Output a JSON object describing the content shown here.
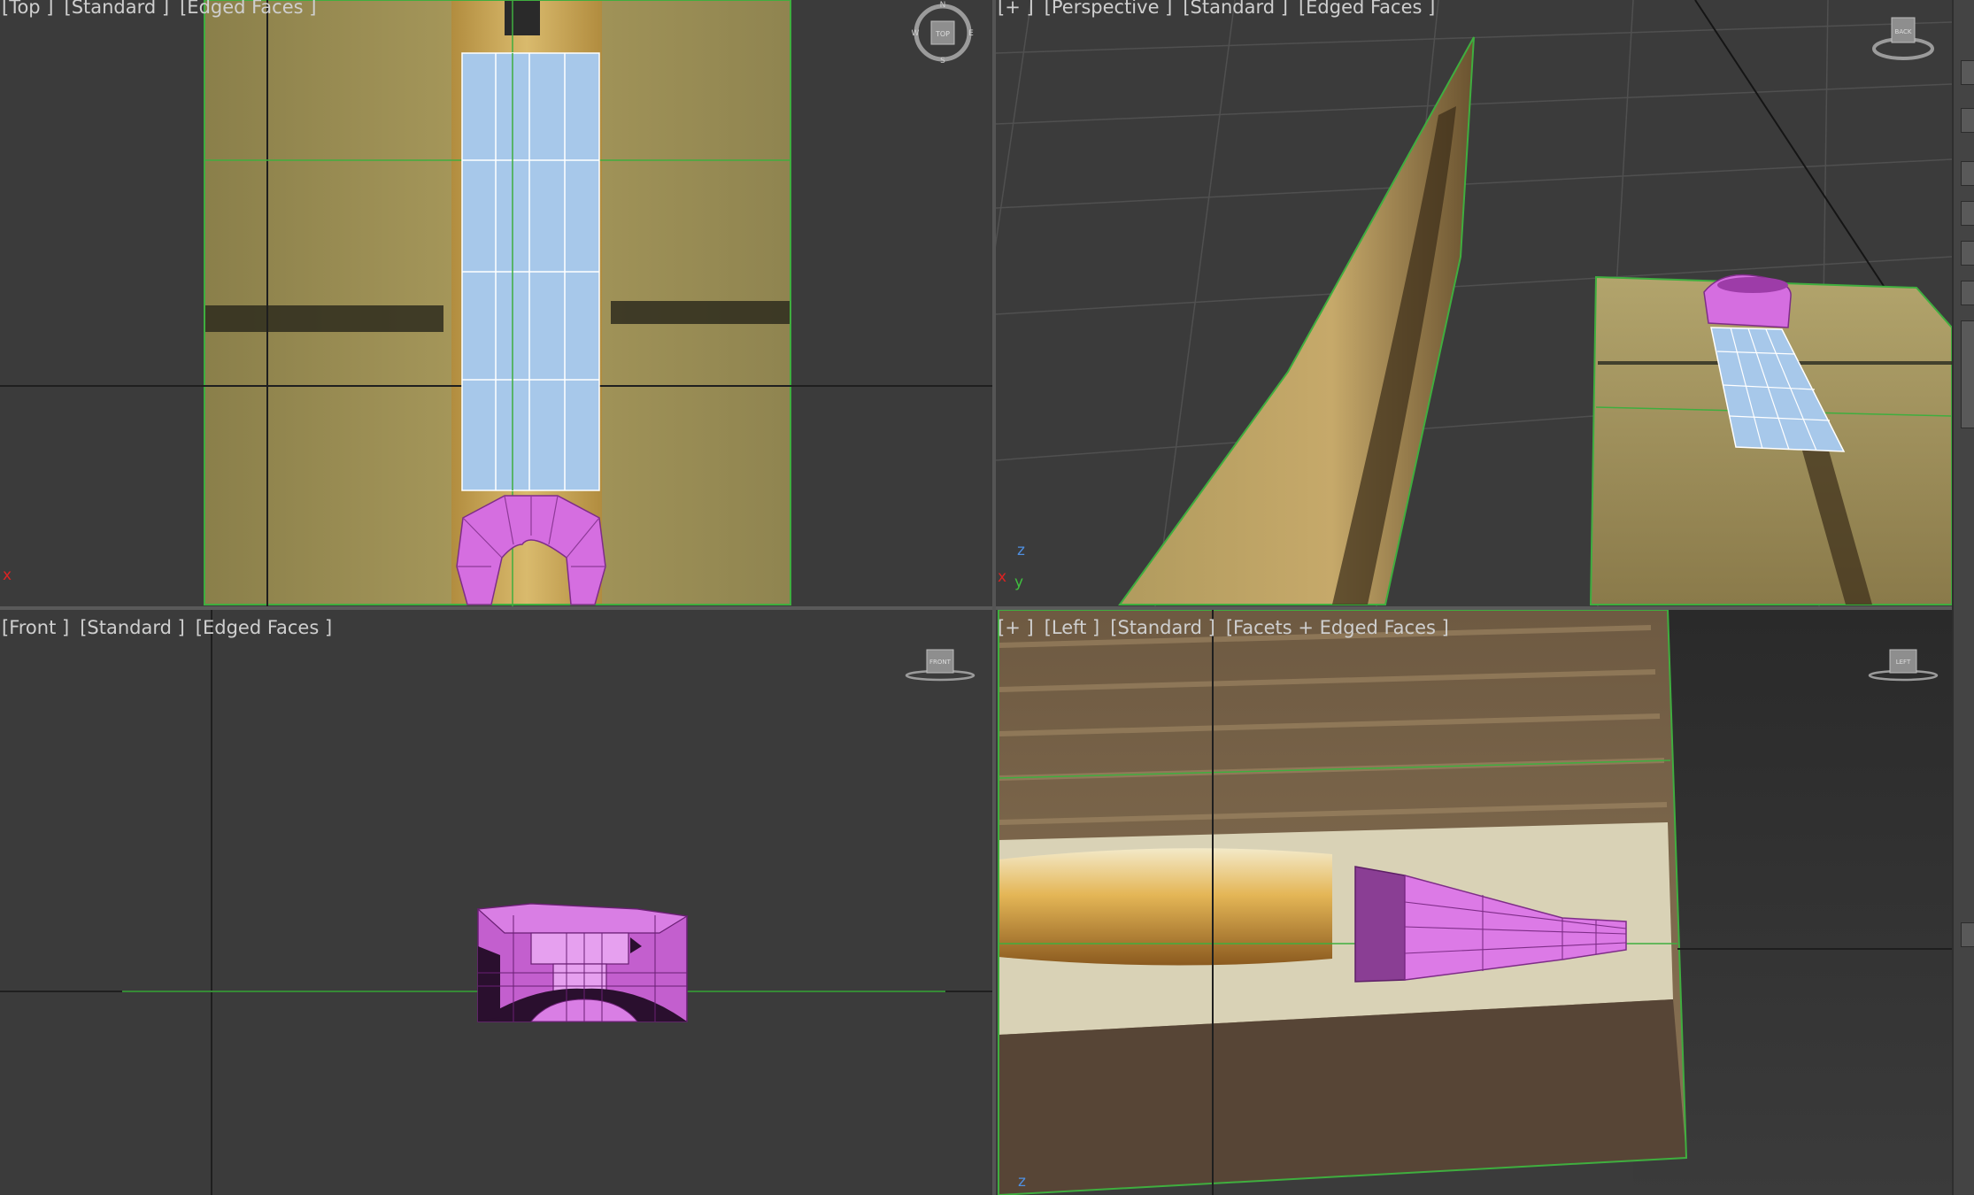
{
  "viewports": {
    "top": {
      "labels": [
        "[Top ]",
        "[Standard ]",
        "[Edged Faces ]"
      ],
      "cube_face": "TOP",
      "compass": [
        "N",
        "E",
        "S",
        "W"
      ],
      "axis_x": "x"
    },
    "perspective": {
      "labels": [
        "[+ ]",
        "[Perspective ]",
        "[Standard ]",
        "[Edged Faces ]"
      ],
      "cube_face": "BACK",
      "axis_x": "x",
      "axis_y": "y",
      "axis_z": "z"
    },
    "front": {
      "labels": [
        "[Front ]",
        "[Standard ]",
        "[Edged Faces ]"
      ],
      "cube_face": "FRONT"
    },
    "left": {
      "labels": [
        "[+ ]",
        "[Left ]",
        "[Standard ]",
        "[Facets + Edged Faces ]"
      ],
      "cube_face": "LEFT",
      "axis_z": "z"
    }
  },
  "colors": {
    "viewport_bg": "#3b3b3b",
    "selection_magenta": "#d56ee0",
    "plane_blue": "#a7c8ea",
    "grid_green": "#3fae3f",
    "active_border": "#c8a64a"
  },
  "icons": {
    "viewcube": "viewcube-icon",
    "compass": "compass-ring-icon",
    "axis": "axis-tripod-icon"
  }
}
